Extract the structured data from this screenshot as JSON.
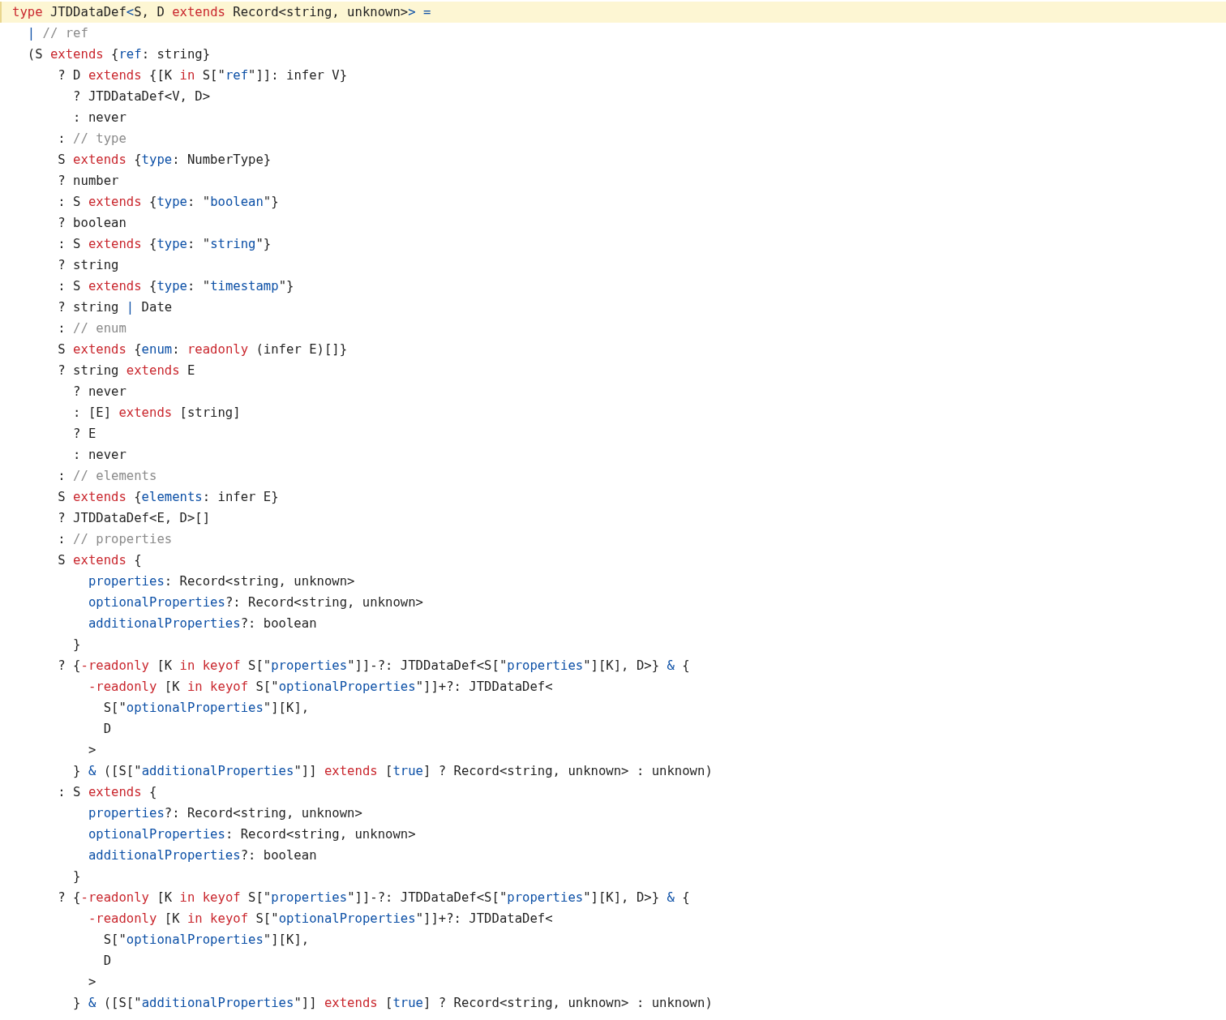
{
  "code_lines": [
    {
      "highlighted": true,
      "tokens": [
        {
          "kind": "keyword",
          "text": "type"
        },
        {
          "kind": "plain",
          "text": " JTDDataDef"
        },
        {
          "kind": "accent",
          "text": "<"
        },
        {
          "kind": "plain",
          "text": "S, D "
        },
        {
          "kind": "keyword",
          "text": "extends"
        },
        {
          "kind": "plain",
          "text": " Record<string, unknown>"
        },
        {
          "kind": "accent",
          "text": "> ="
        }
      ]
    },
    {
      "highlighted": false,
      "tokens": [
        {
          "kind": "accent",
          "text": "  |"
        },
        {
          "kind": "comment",
          "text": " // ref"
        }
      ]
    },
    {
      "highlighted": false,
      "tokens": [
        {
          "kind": "plain",
          "text": "  (S "
        },
        {
          "kind": "keyword",
          "text": "extends"
        },
        {
          "kind": "plain",
          "text": " {"
        },
        {
          "kind": "accent",
          "text": "ref"
        },
        {
          "kind": "plain",
          "text": ": string}"
        }
      ]
    },
    {
      "highlighted": false,
      "tokens": [
        {
          "kind": "plain",
          "text": "      ? D "
        },
        {
          "kind": "keyword",
          "text": "extends"
        },
        {
          "kind": "plain",
          "text": " {[K "
        },
        {
          "kind": "keyword",
          "text": "in"
        },
        {
          "kind": "plain",
          "text": " S[\""
        },
        {
          "kind": "accent",
          "text": "ref"
        },
        {
          "kind": "plain",
          "text": "\"]]: infer V}"
        }
      ]
    },
    {
      "highlighted": false,
      "tokens": [
        {
          "kind": "plain",
          "text": "        ? JTDDataDef<V, D>"
        }
      ]
    },
    {
      "highlighted": false,
      "tokens": [
        {
          "kind": "plain",
          "text": "        : never"
        }
      ]
    },
    {
      "highlighted": false,
      "tokens": [
        {
          "kind": "plain",
          "text": "      : "
        },
        {
          "kind": "comment",
          "text": "// type"
        }
      ]
    },
    {
      "highlighted": false,
      "tokens": [
        {
          "kind": "plain",
          "text": "      S "
        },
        {
          "kind": "keyword",
          "text": "extends"
        },
        {
          "kind": "plain",
          "text": " {"
        },
        {
          "kind": "accent",
          "text": "type"
        },
        {
          "kind": "plain",
          "text": ": NumberType}"
        }
      ]
    },
    {
      "highlighted": false,
      "tokens": [
        {
          "kind": "plain",
          "text": "      ? number"
        }
      ]
    },
    {
      "highlighted": false,
      "tokens": [
        {
          "kind": "plain",
          "text": "      : S "
        },
        {
          "kind": "keyword",
          "text": "extends"
        },
        {
          "kind": "plain",
          "text": " {"
        },
        {
          "kind": "accent",
          "text": "type"
        },
        {
          "kind": "plain",
          "text": ": \""
        },
        {
          "kind": "accent",
          "text": "boolean"
        },
        {
          "kind": "plain",
          "text": "\"}"
        }
      ]
    },
    {
      "highlighted": false,
      "tokens": [
        {
          "kind": "plain",
          "text": "      ? boolean"
        }
      ]
    },
    {
      "highlighted": false,
      "tokens": [
        {
          "kind": "plain",
          "text": "      : S "
        },
        {
          "kind": "keyword",
          "text": "extends"
        },
        {
          "kind": "plain",
          "text": " {"
        },
        {
          "kind": "accent",
          "text": "type"
        },
        {
          "kind": "plain",
          "text": ": \""
        },
        {
          "kind": "accent",
          "text": "string"
        },
        {
          "kind": "plain",
          "text": "\"}"
        }
      ]
    },
    {
      "highlighted": false,
      "tokens": [
        {
          "kind": "plain",
          "text": "      ? string"
        }
      ]
    },
    {
      "highlighted": false,
      "tokens": [
        {
          "kind": "plain",
          "text": "      : S "
        },
        {
          "kind": "keyword",
          "text": "extends"
        },
        {
          "kind": "plain",
          "text": " {"
        },
        {
          "kind": "accent",
          "text": "type"
        },
        {
          "kind": "plain",
          "text": ": \""
        },
        {
          "kind": "accent",
          "text": "timestamp"
        },
        {
          "kind": "plain",
          "text": "\"}"
        }
      ]
    },
    {
      "highlighted": false,
      "tokens": [
        {
          "kind": "plain",
          "text": "      ? string "
        },
        {
          "kind": "accent",
          "text": "|"
        },
        {
          "kind": "plain",
          "text": " Date"
        }
      ]
    },
    {
      "highlighted": false,
      "tokens": [
        {
          "kind": "plain",
          "text": "      : "
        },
        {
          "kind": "comment",
          "text": "// enum"
        }
      ]
    },
    {
      "highlighted": false,
      "tokens": [
        {
          "kind": "plain",
          "text": "      S "
        },
        {
          "kind": "keyword",
          "text": "extends"
        },
        {
          "kind": "plain",
          "text": " {"
        },
        {
          "kind": "accent",
          "text": "enum"
        },
        {
          "kind": "plain",
          "text": ": "
        },
        {
          "kind": "keyword",
          "text": "readonly"
        },
        {
          "kind": "plain",
          "text": " (infer E)[]}"
        }
      ]
    },
    {
      "highlighted": false,
      "tokens": [
        {
          "kind": "plain",
          "text": "      ? string "
        },
        {
          "kind": "keyword",
          "text": "extends"
        },
        {
          "kind": "plain",
          "text": " E"
        }
      ]
    },
    {
      "highlighted": false,
      "tokens": [
        {
          "kind": "plain",
          "text": "        ? never"
        }
      ]
    },
    {
      "highlighted": false,
      "tokens": [
        {
          "kind": "plain",
          "text": "        : [E] "
        },
        {
          "kind": "keyword",
          "text": "extends"
        },
        {
          "kind": "plain",
          "text": " [string]"
        }
      ]
    },
    {
      "highlighted": false,
      "tokens": [
        {
          "kind": "plain",
          "text": "        ? E"
        }
      ]
    },
    {
      "highlighted": false,
      "tokens": [
        {
          "kind": "plain",
          "text": "        : never"
        }
      ]
    },
    {
      "highlighted": false,
      "tokens": [
        {
          "kind": "plain",
          "text": "      : "
        },
        {
          "kind": "comment",
          "text": "// elements"
        }
      ]
    },
    {
      "highlighted": false,
      "tokens": [
        {
          "kind": "plain",
          "text": "      S "
        },
        {
          "kind": "keyword",
          "text": "extends"
        },
        {
          "kind": "plain",
          "text": " {"
        },
        {
          "kind": "accent",
          "text": "elements"
        },
        {
          "kind": "plain",
          "text": ": infer E}"
        }
      ]
    },
    {
      "highlighted": false,
      "tokens": [
        {
          "kind": "plain",
          "text": "      ? JTDDataDef<E, D>[]"
        }
      ]
    },
    {
      "highlighted": false,
      "tokens": [
        {
          "kind": "plain",
          "text": "      : "
        },
        {
          "kind": "comment",
          "text": "// properties"
        }
      ]
    },
    {
      "highlighted": false,
      "tokens": [
        {
          "kind": "plain",
          "text": "      S "
        },
        {
          "kind": "keyword",
          "text": "extends"
        },
        {
          "kind": "plain",
          "text": " {"
        }
      ]
    },
    {
      "highlighted": false,
      "tokens": [
        {
          "kind": "accent",
          "text": "          properties"
        },
        {
          "kind": "plain",
          "text": ": Record<string, unknown>"
        }
      ]
    },
    {
      "highlighted": false,
      "tokens": [
        {
          "kind": "accent",
          "text": "          optionalProperties"
        },
        {
          "kind": "plain",
          "text": "?: Record<string, unknown>"
        }
      ]
    },
    {
      "highlighted": false,
      "tokens": [
        {
          "kind": "accent",
          "text": "          additionalProperties"
        },
        {
          "kind": "plain",
          "text": "?: boolean"
        }
      ]
    },
    {
      "highlighted": false,
      "tokens": [
        {
          "kind": "plain",
          "text": "        }"
        }
      ]
    },
    {
      "highlighted": false,
      "tokens": [
        {
          "kind": "plain",
          "text": "      ? {"
        },
        {
          "kind": "keyword",
          "text": "-readonly"
        },
        {
          "kind": "plain",
          "text": " [K "
        },
        {
          "kind": "keyword",
          "text": "in keyof"
        },
        {
          "kind": "plain",
          "text": " S[\""
        },
        {
          "kind": "accent",
          "text": "properties"
        },
        {
          "kind": "plain",
          "text": "\"]]-?: JTDDataDef<S[\""
        },
        {
          "kind": "accent",
          "text": "properties"
        },
        {
          "kind": "plain",
          "text": "\"][K], D>} "
        },
        {
          "kind": "accent",
          "text": "&"
        },
        {
          "kind": "plain",
          "text": " {"
        }
      ]
    },
    {
      "highlighted": false,
      "tokens": [
        {
          "kind": "keyword",
          "text": "          -readonly"
        },
        {
          "kind": "plain",
          "text": " [K "
        },
        {
          "kind": "keyword",
          "text": "in keyof"
        },
        {
          "kind": "plain",
          "text": " S[\""
        },
        {
          "kind": "accent",
          "text": "optionalProperties"
        },
        {
          "kind": "plain",
          "text": "\"]]+?: JTDDataDef<"
        }
      ]
    },
    {
      "highlighted": false,
      "tokens": [
        {
          "kind": "plain",
          "text": "            S[\""
        },
        {
          "kind": "accent",
          "text": "optionalProperties"
        },
        {
          "kind": "plain",
          "text": "\"][K],"
        }
      ]
    },
    {
      "highlighted": false,
      "tokens": [
        {
          "kind": "plain",
          "text": "            D"
        }
      ]
    },
    {
      "highlighted": false,
      "tokens": [
        {
          "kind": "plain",
          "text": "          >"
        }
      ]
    },
    {
      "highlighted": false,
      "tokens": [
        {
          "kind": "plain",
          "text": "        } "
        },
        {
          "kind": "accent",
          "text": "&"
        },
        {
          "kind": "plain",
          "text": " ([S[\""
        },
        {
          "kind": "accent",
          "text": "additionalProperties"
        },
        {
          "kind": "plain",
          "text": "\"]] "
        },
        {
          "kind": "keyword",
          "text": "extends"
        },
        {
          "kind": "plain",
          "text": " ["
        },
        {
          "kind": "accent",
          "text": "true"
        },
        {
          "kind": "plain",
          "text": "] ? Record<string, unknown> : unknown)"
        }
      ]
    },
    {
      "highlighted": false,
      "tokens": [
        {
          "kind": "plain",
          "text": "      : S "
        },
        {
          "kind": "keyword",
          "text": "extends"
        },
        {
          "kind": "plain",
          "text": " {"
        }
      ]
    },
    {
      "highlighted": false,
      "tokens": [
        {
          "kind": "accent",
          "text": "          properties"
        },
        {
          "kind": "plain",
          "text": "?: Record<string, unknown>"
        }
      ]
    },
    {
      "highlighted": false,
      "tokens": [
        {
          "kind": "accent",
          "text": "          optionalProperties"
        },
        {
          "kind": "plain",
          "text": ": Record<string, unknown>"
        }
      ]
    },
    {
      "highlighted": false,
      "tokens": [
        {
          "kind": "accent",
          "text": "          additionalProperties"
        },
        {
          "kind": "plain",
          "text": "?: boolean"
        }
      ]
    },
    {
      "highlighted": false,
      "tokens": [
        {
          "kind": "plain",
          "text": "        }"
        }
      ]
    },
    {
      "highlighted": false,
      "tokens": [
        {
          "kind": "plain",
          "text": "      ? {"
        },
        {
          "kind": "keyword",
          "text": "-readonly"
        },
        {
          "kind": "plain",
          "text": " [K "
        },
        {
          "kind": "keyword",
          "text": "in keyof"
        },
        {
          "kind": "plain",
          "text": " S[\""
        },
        {
          "kind": "accent",
          "text": "properties"
        },
        {
          "kind": "plain",
          "text": "\"]]-?: JTDDataDef<S[\""
        },
        {
          "kind": "accent",
          "text": "properties"
        },
        {
          "kind": "plain",
          "text": "\"][K], D>} "
        },
        {
          "kind": "accent",
          "text": "&"
        },
        {
          "kind": "plain",
          "text": " {"
        }
      ]
    },
    {
      "highlighted": false,
      "tokens": [
        {
          "kind": "keyword",
          "text": "          -readonly"
        },
        {
          "kind": "plain",
          "text": " [K "
        },
        {
          "kind": "keyword",
          "text": "in keyof"
        },
        {
          "kind": "plain",
          "text": " S[\""
        },
        {
          "kind": "accent",
          "text": "optionalProperties"
        },
        {
          "kind": "plain",
          "text": "\"]]+?: JTDDataDef<"
        }
      ]
    },
    {
      "highlighted": false,
      "tokens": [
        {
          "kind": "plain",
          "text": "            S[\""
        },
        {
          "kind": "accent",
          "text": "optionalProperties"
        },
        {
          "kind": "plain",
          "text": "\"][K],"
        }
      ]
    },
    {
      "highlighted": false,
      "tokens": [
        {
          "kind": "plain",
          "text": "            D"
        }
      ]
    },
    {
      "highlighted": false,
      "tokens": [
        {
          "kind": "plain",
          "text": "          >"
        }
      ]
    },
    {
      "highlighted": false,
      "tokens": [
        {
          "kind": "plain",
          "text": "        } "
        },
        {
          "kind": "accent",
          "text": "&"
        },
        {
          "kind": "plain",
          "text": " ([S[\""
        },
        {
          "kind": "accent",
          "text": "additionalProperties"
        },
        {
          "kind": "plain",
          "text": "\"]] "
        },
        {
          "kind": "keyword",
          "text": "extends"
        },
        {
          "kind": "plain",
          "text": " ["
        },
        {
          "kind": "accent",
          "text": "true"
        },
        {
          "kind": "plain",
          "text": "] ? Record<string, unknown> : unknown)"
        }
      ]
    }
  ]
}
